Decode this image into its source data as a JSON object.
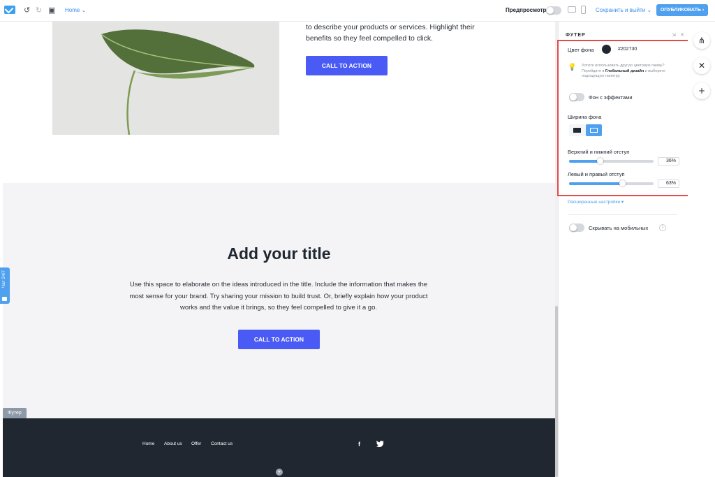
{
  "topbar": {
    "page_name": "Home",
    "preview_label": "Предпросмотр",
    "save_exit_label": "Сохранить и выйти",
    "publish_label": "ОПУБЛИКОВАТЬ",
    "icons": [
      "logo-icon",
      "undo-icon",
      "redo-icon",
      "save-icon",
      "chevron-down-icon",
      "desktop-icon",
      "mobile-icon"
    ]
  },
  "canvas": {
    "hero_text": "to describe your products or services. Highlight their benefits so they feel compelled to click.",
    "hero_cta": "CALL TO ACTION",
    "section_title": "Add your title",
    "section_body": "Use this space to elaborate on the ideas introduced in the title. Include the information that makes the most sense for your brand. Try sharing your mission to build trust. Or, briefly explain how your product works and the value it brings, so they feel compelled to give it a go.",
    "section_cta": "CALL TO ACTION",
    "footer_tag": "Футер",
    "footer_links": [
      "Home",
      "About us",
      "Offer",
      "Contact us"
    ],
    "social": {
      "facebook": "f",
      "twitter": "t"
    },
    "chat_label": "Чат 24/7"
  },
  "panel": {
    "title": "ФУТЕР",
    "bg_color_label": "Цвет фона",
    "bg_color_value": "#202730",
    "hint_text": "Хотите использовать другую цветовую гамму? Перейдите в",
    "hint_link": "Глобальный дизайн",
    "hint_tail": "и выберите подходящую палитру.",
    "effects_label": "Фон с эффектами",
    "effects_on": false,
    "width_label": "Ширина фона",
    "padding_v_label": "Верхний и нижний отступ",
    "padding_v_value": "36%",
    "padding_v_fraction": 0.36,
    "padding_h_label": "Левый и правый отступ",
    "padding_h_value": "63%",
    "padding_h_fraction": 0.63,
    "advanced_label": "Расширенные настройки",
    "hide_mobile_label": "Скрывать на мобильных",
    "hide_mobile_on": false
  },
  "rail": {
    "icons": [
      "sitemap-icon",
      "close-icon",
      "add-icon"
    ]
  },
  "colors": {
    "accent": "#4a5af5",
    "brand_blue": "#4fa0ef",
    "footer_bg": "#202730",
    "highlight": "#e34a4a"
  }
}
